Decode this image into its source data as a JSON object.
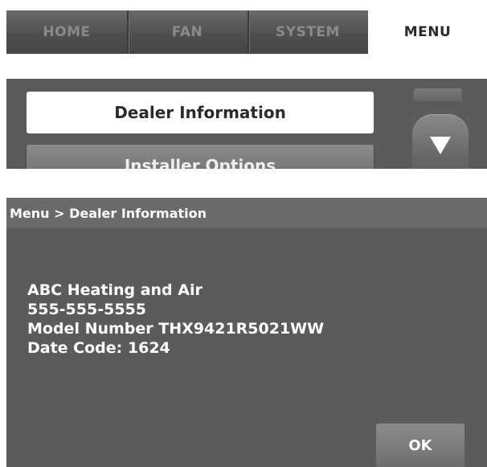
{
  "tabs": [
    {
      "label": "HOME",
      "active": false
    },
    {
      "label": "FAN",
      "active": false
    },
    {
      "label": "SYSTEM",
      "active": false
    },
    {
      "label": "MENU",
      "active": true
    }
  ],
  "menu": {
    "items": [
      {
        "label": "Dealer Information",
        "selected": true
      },
      {
        "label": "Installer Options",
        "selected": false
      }
    ],
    "scroll_down_icon": "down-arrow-icon"
  },
  "dealer_screen": {
    "breadcrumb": "Menu > Dealer Information",
    "lines": [
      "ABC Heating and Air",
      "555-555-5555",
      "Model Number THX9421R5021WW",
      "Date Code: 1624"
    ],
    "ok_label": "OK"
  },
  "colors": {
    "panel": "#5b5b5b",
    "tabbar": "#4f4f4f",
    "active_tab": "#ffffff"
  }
}
